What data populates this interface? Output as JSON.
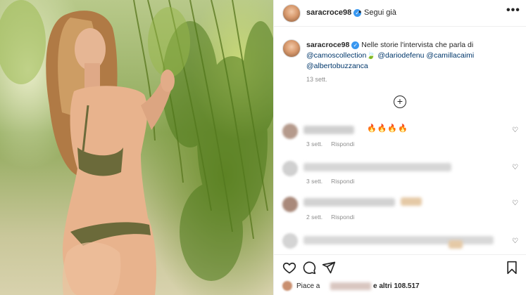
{
  "post": {
    "username": "saracroce98",
    "verified_mark": "✓",
    "separator": "•",
    "follow_label": "Segui già",
    "more_label": "•••"
  },
  "caption": {
    "username": "saracroce98",
    "text": " Nelle storie l'intervista che parla di ",
    "mentions": [
      "@camoscollection",
      "@dariodefenu",
      "@camillacaimi",
      "@albertobuzzanca"
    ],
    "leaf_emoji": "🍃",
    "time": "13 sett."
  },
  "load_more_label": "+",
  "comments": [
    {
      "emoji": "🔥🔥🔥🔥",
      "time": "3 sett.",
      "reply": "Rispondi"
    },
    {
      "time": "3 sett.",
      "reply": "Rispondi"
    },
    {
      "time": "2 sett.",
      "reply": "Rispondi"
    },
    {
      "time": "",
      "reply": ""
    }
  ],
  "heart_glyph": "♡",
  "likes": {
    "prefix": "Piace a",
    "others": "e altri 108.517"
  },
  "icons": [
    "like-icon",
    "comment-icon",
    "share-icon",
    "save-icon",
    "more-icon",
    "add-comment-icon"
  ]
}
